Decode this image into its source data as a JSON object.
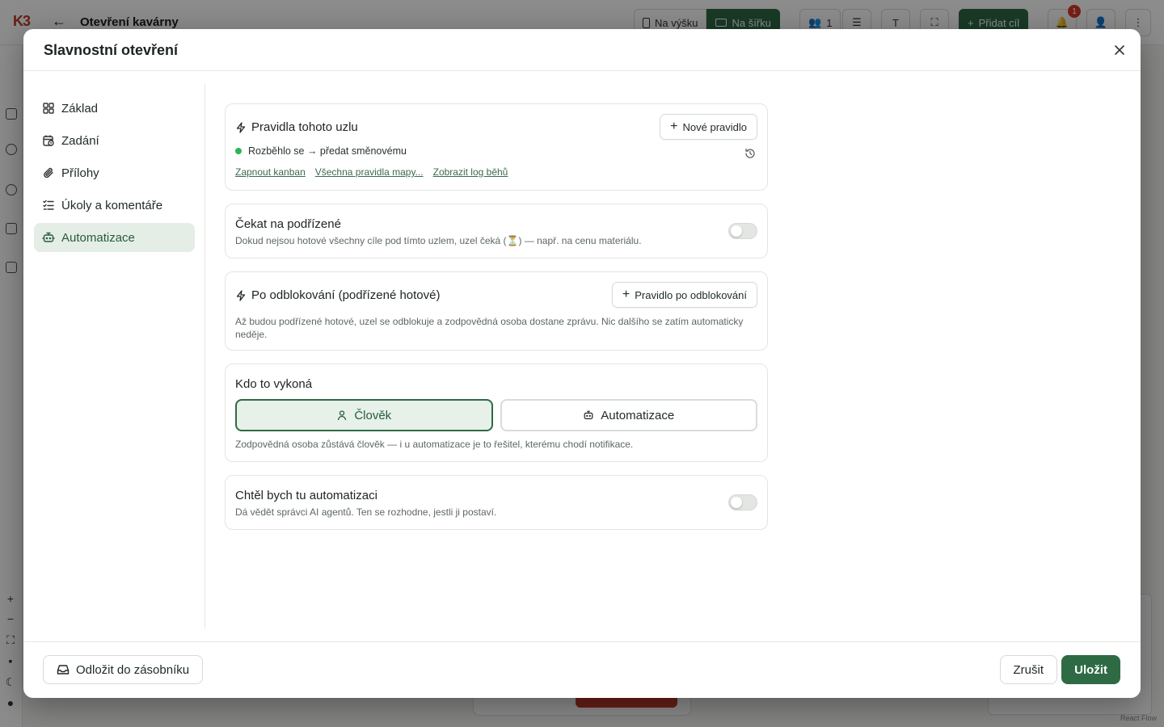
{
  "background": {
    "logo": "K3",
    "app_title": "Otevření kavárny",
    "toolbar": {
      "portrait_label": "Na výšku",
      "landscape_label": "Na šířku",
      "users_count": "1",
      "add_goal_label": "Přidat cíl",
      "notification_count": "1"
    },
    "corner_text": "React Flow"
  },
  "modal": {
    "title": "Slavnostní otevření",
    "nav": [
      {
        "label": "Základ",
        "icon": "grid-icon"
      },
      {
        "label": "Zadání",
        "icon": "calendar-clock-icon"
      },
      {
        "label": "Přílohy",
        "icon": "paperclip-icon"
      },
      {
        "label": "Úkoly a komentáře",
        "icon": "list-checks-icon"
      },
      {
        "label": "Automatizace",
        "icon": "bot-icon",
        "active": true
      }
    ],
    "rules_card": {
      "title": "Pravidla tohoto uzlu",
      "new_rule_label": "Nové pravidlo",
      "rule_text": "Rozběhlo se → předat směnovému",
      "rule_status_color": "#2fb35a",
      "links": [
        "Zapnout kanban",
        "Všechna pravidla mapy...",
        "Zobrazit log běhů"
      ]
    },
    "wait_card": {
      "title": "Čekat na podřízené",
      "description": "Dokud nejsou hotové všechny cíle pod tímto uzlem, uzel čeká (⏳) — např. na cenu materiálu.",
      "enabled": false
    },
    "unblock_card": {
      "title": "Po odblokování (podřízené hotové)",
      "button_label": "Pravidlo po odblokování",
      "description": "Až budou podřízené hotové, uzel se odblokuje a zodpovědná osoba dostane zprávu. Nic dalšího se zatím automaticky neděje."
    },
    "executor_card": {
      "title": "Kdo to vykoná",
      "options": [
        "Člověk",
        "Automatizace"
      ],
      "selected": "Člověk",
      "description": "Zodpovědná osoba zůstává člověk — i u automatizace je to řešitel, kterému chodí notifikace."
    },
    "request_card": {
      "title": "Chtěl bych tu automatizaci",
      "description": "Dá vědět správci AI agentů. Ten se rozhodne, jestli ji postaví.",
      "enabled": false
    },
    "footer": {
      "postpone_label": "Odložit do zásobníku",
      "cancel_label": "Zrušit",
      "save_label": "Uložit"
    },
    "colors": {
      "accent": "#2e6b45",
      "accent_bg": "#e4ede6"
    }
  }
}
